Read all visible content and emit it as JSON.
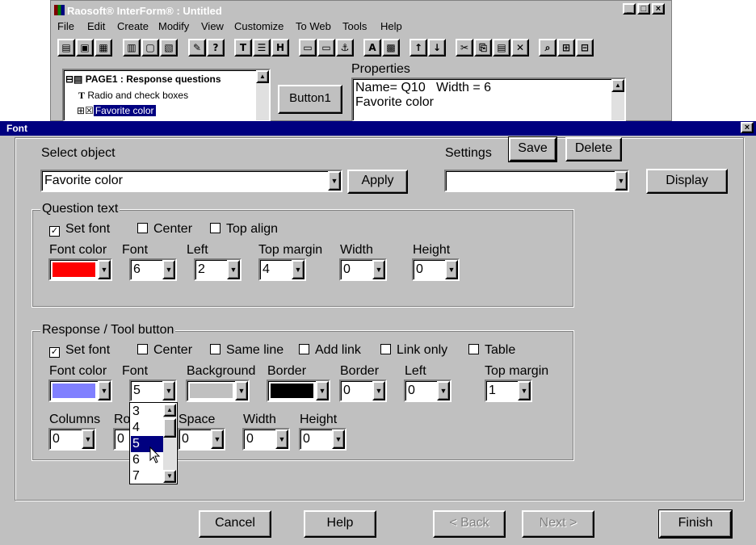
{
  "bgwin": {
    "title": "Raosoft® InterForm® : Untitled",
    "menu": [
      "File",
      "Edit",
      "Create",
      "Modify",
      "View",
      "Customize",
      "To Web",
      "Tools",
      "Help"
    ],
    "tree": [
      "PAGE1 : Response questions",
      "Radio and check boxes",
      "Favorite color"
    ],
    "button1": "Button1",
    "props_label": "Properties",
    "props_line1": "Name= Q10   Width = 6",
    "props_line2": "Favorite color"
  },
  "dialog": {
    "title": "Font",
    "select_object_label": "Select object",
    "select_object_value": "Favorite color",
    "apply": "Apply",
    "settings_label": "Settings",
    "save": "Save",
    "delete": "Delete",
    "settings_value": "",
    "display": "Display",
    "qtext": {
      "title": "Question text",
      "set_font": "Set font",
      "center": "Center",
      "top_align": "Top align",
      "font_color_label": "Font color",
      "font_color": "#ff0000",
      "font_label": "Font",
      "font_value": "6",
      "left_label": "Left",
      "left_value": "2",
      "top_margin_label": "Top margin",
      "top_margin_value": "4",
      "width_label": "Width",
      "width_value": "0",
      "height_label": "Height",
      "height_value": "0"
    },
    "resp": {
      "title": "Response / Tool button",
      "set_font": "Set font",
      "center": "Center",
      "same_line": "Same line",
      "add_link": "Add link",
      "link_only": "Link only",
      "table": "Table",
      "font_color_label": "Font color",
      "font_color": "#8080ff",
      "font_label": "Font",
      "font_value": "5",
      "background_label": "Background",
      "background_color": "#c0c0c0",
      "border_color_label": "Border",
      "border_color": "#000000",
      "border_label": "Border",
      "border_value": "0",
      "left_label": "Left",
      "left_value": "0",
      "top_margin_label": "Top margin",
      "top_margin_value": "1",
      "columns_label": "Columns",
      "columns_value": "0",
      "rows_label": "Ro",
      "rows_value": "0",
      "space_label": "Space",
      "space_value": "0",
      "width_label": "Width",
      "width_value": "0",
      "height_label": "Height",
      "height_value": "0"
    },
    "dropdown_options": [
      "3",
      "4",
      "5",
      "6",
      "7"
    ],
    "dropdown_selected": "5",
    "cancel": "Cancel",
    "help": "Help",
    "back": "< Back",
    "next": "Next >",
    "finish": "Finish"
  }
}
